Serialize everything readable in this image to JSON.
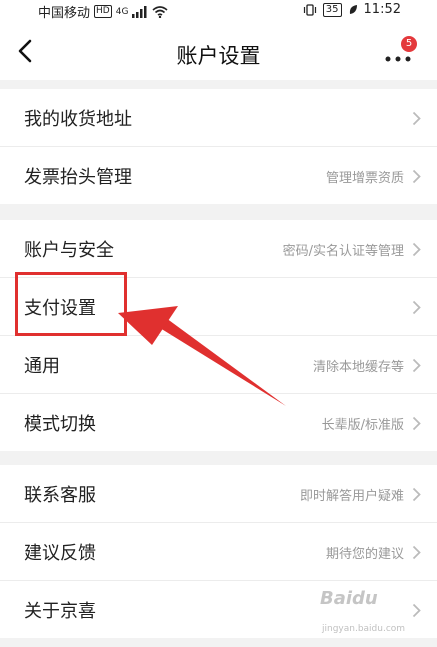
{
  "status_bar": {
    "carrier": "中国移动",
    "hd": "HD",
    "network": "4G",
    "battery": "35",
    "time": "11:52"
  },
  "nav": {
    "title": "账户设置",
    "notification_count": "5"
  },
  "groups": [
    [
      {
        "label": "我的收货地址",
        "sub": ""
      },
      {
        "label": "发票抬头管理",
        "sub": "管理增票资质"
      }
    ],
    [
      {
        "label": "账户与安全",
        "sub": "密码/实名认证等管理"
      },
      {
        "label": "支付设置",
        "sub": ""
      },
      {
        "label": "通用",
        "sub": "清除本地缓存等"
      },
      {
        "label": "模式切换",
        "sub": "长辈版/标准版"
      }
    ],
    [
      {
        "label": "联系客服",
        "sub": "即时解答用户疑难"
      },
      {
        "label": "建议反馈",
        "sub": "期待您的建议"
      },
      {
        "label": "关于京喜",
        "sub": ""
      }
    ]
  ],
  "watermark": {
    "text": "Baidu",
    "sub": "jingyan.baidu.com"
  },
  "colors": {
    "highlight": "#e0302f",
    "badge": "#e4393c",
    "background": "#f2f2f2"
  }
}
